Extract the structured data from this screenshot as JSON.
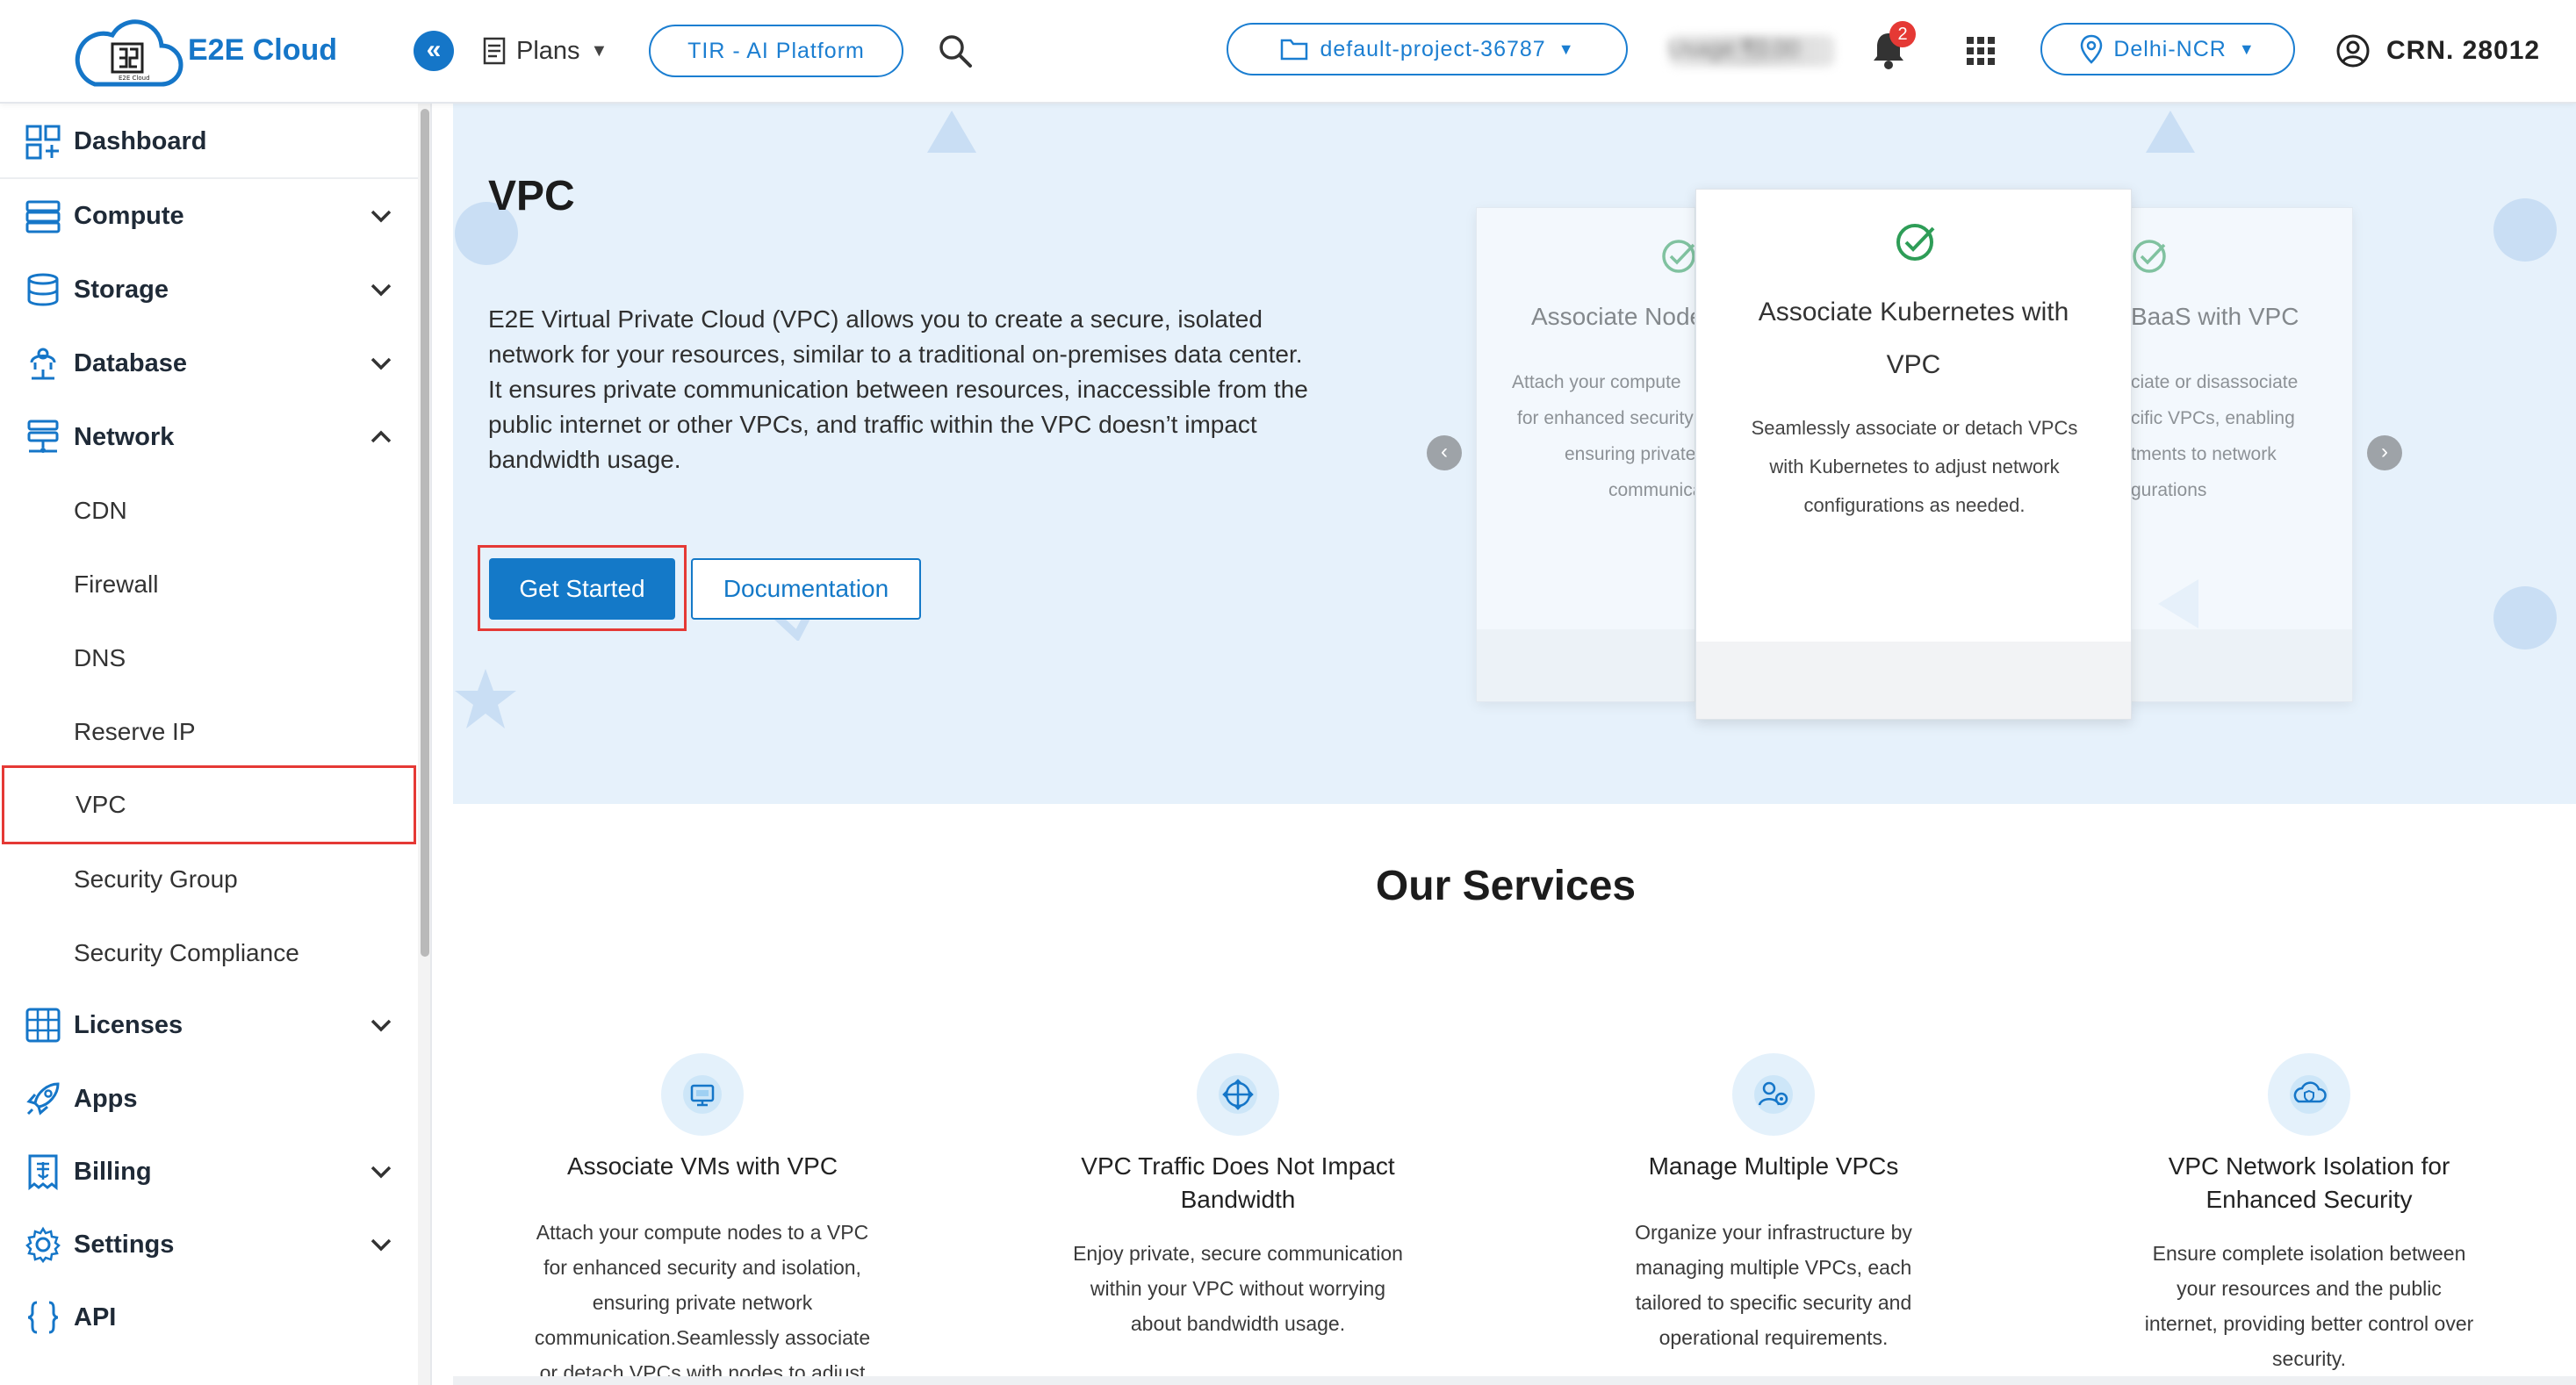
{
  "header": {
    "logo_text": "E2E Cloud",
    "plans_label": "Plans",
    "tir_button": "TIR - AI Platform",
    "project_selector": "default-project-36787",
    "usage_text": "Usage ₹0.00",
    "notification_count": "2",
    "region_selector": "Delhi-NCR",
    "account_label": "CRN. 28012"
  },
  "sidebar": {
    "dashboard": "Dashboard",
    "compute": "Compute",
    "storage": "Storage",
    "database": "Database",
    "network": "Network",
    "network_items": [
      "CDN",
      "Firewall",
      "DNS",
      "Reserve IP",
      "VPC",
      "Security Group",
      "Security Compliance"
    ],
    "licenses": "Licenses",
    "apps": "Apps",
    "billing": "Billing",
    "settings": "Settings",
    "api": "API"
  },
  "hero": {
    "title": "VPC",
    "description": "E2E Virtual Private Cloud (VPC) allows you to create a secure, isolated network for your resources, similar to a traditional on-premises data center. It ensures private communication between resources, inaccessible from the public internet or other VPCs, and traffic within the VPC doesn’t impact bandwidth usage.",
    "get_started": "Get Started",
    "documentation": "Documentation"
  },
  "carousel": {
    "left_card": {
      "title": "Associate Nodes",
      "desc_lines": [
        "Attach your compute",
        "for enhanced security",
        "ensuring private",
        "communication"
      ]
    },
    "center_card": {
      "title_line1": "Associate Kubernetes with",
      "title_line2": "VPC",
      "desc_line1": "Seamlessly associate or detach VPCs",
      "desc_line2": "with Kubernetes to adjust network",
      "desc_line3": "configurations as needed."
    },
    "right_card": {
      "title": "BaaS with VPC",
      "desc_lines": [
        "ciate or disassociate",
        "cific VPCs, enabling",
        "tments to network",
        "gurations"
      ]
    }
  },
  "services": {
    "title": "Our Services",
    "items": [
      {
        "title": "Associate VMs with VPC",
        "desc": [
          "Attach your compute nodes to a VPC",
          "for enhanced security and isolation,",
          "ensuring private network",
          "communication.Seamlessly associate",
          "or detach VPCs with nodes to adjust"
        ]
      },
      {
        "title_lines": [
          "VPC Traffic Does Not Impact",
          "Bandwidth"
        ],
        "desc": [
          "Enjoy private, secure communication",
          "within your VPC without worrying",
          "about bandwidth usage."
        ]
      },
      {
        "title": "Manage Multiple VPCs",
        "desc": [
          "Organize your infrastructure by",
          "managing multiple VPCs, each",
          "tailored to specific security and",
          "operational requirements."
        ]
      },
      {
        "title_lines": [
          "VPC Network Isolation for",
          "Enhanced Security"
        ],
        "desc": [
          "Ensure complete isolation between",
          "your resources and the public",
          "internet, providing better control over",
          "security."
        ]
      }
    ]
  },
  "colors": {
    "brand_blue": "#1479c8",
    "highlight_red": "#e53935",
    "hero_bg": "#e6f1fb",
    "check_green": "#2e9d57"
  }
}
